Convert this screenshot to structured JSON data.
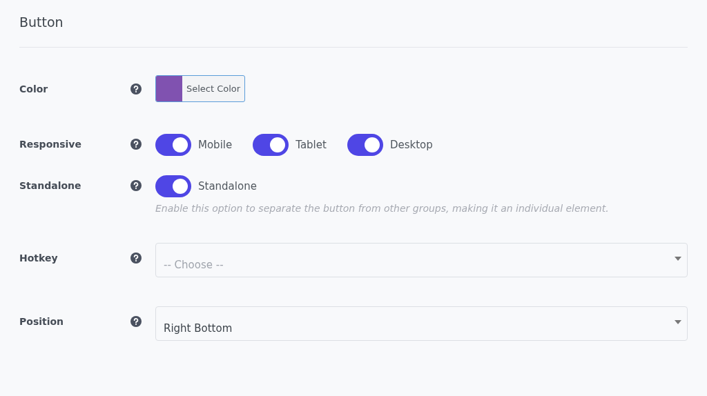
{
  "title": "Button",
  "fields": [
    {
      "kind": "color",
      "label": "Color",
      "color": "#8052b0",
      "button": "Select Color"
    },
    {
      "kind": "toggles",
      "label": "Responsive",
      "toggles": [
        {
          "label": "Mobile",
          "on": true
        },
        {
          "label": "Tablet",
          "on": true
        },
        {
          "label": "Desktop",
          "on": true
        }
      ]
    },
    {
      "kind": "toggles",
      "label": "Standalone",
      "toggles": [
        {
          "label": "Standalone",
          "on": true
        }
      ],
      "help": "Enable this option to separate the button from other groups, making it an individual element."
    },
    {
      "kind": "select",
      "label": "Hotkey",
      "placeholder": "-- Choose --"
    },
    {
      "kind": "select",
      "label": "Position",
      "value": "Right Bottom"
    }
  ]
}
